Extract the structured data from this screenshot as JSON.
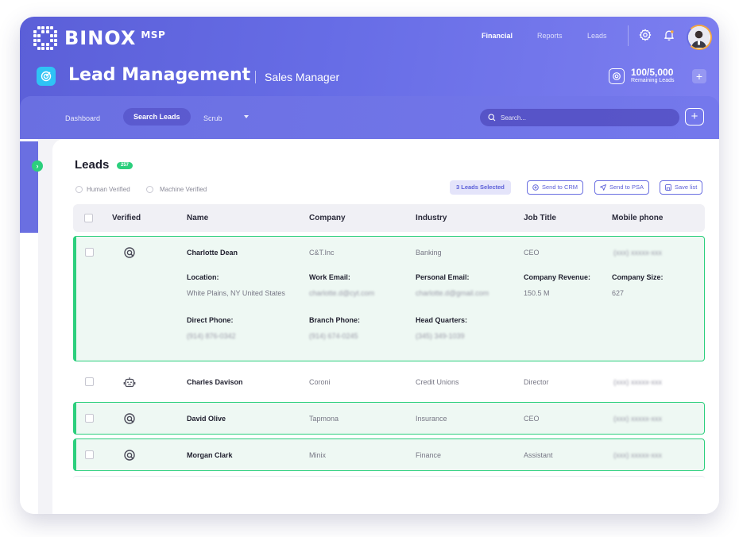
{
  "brand": {
    "name": "BINOX",
    "suffix": "MSP"
  },
  "topnav": {
    "items": [
      {
        "label": "Financial",
        "active": true
      },
      {
        "label": "Reports",
        "active": false
      },
      {
        "label": "Leads",
        "active": false
      }
    ]
  },
  "header": {
    "title": "Lead Management",
    "subtitle": "Sales Manager",
    "credits_value": "100/5,000",
    "credits_label": "Remaining Leads",
    "plus_label": "+"
  },
  "subnav": {
    "items": [
      {
        "label": "Dashboard",
        "active": false
      },
      {
        "label": "Search Leads",
        "active": true
      },
      {
        "label": "Scrub",
        "active": false
      }
    ],
    "search_placeholder": "Search...",
    "add_label": "+"
  },
  "rail": {
    "toggle_label": "›"
  },
  "leads": {
    "title": "Leads",
    "count": "257",
    "filters": [
      "Human Verified",
      "Machine Verified"
    ],
    "selected_label": "3 Leads Selected",
    "actions": [
      "Send to CRM",
      "Send to PSA",
      "Save list"
    ],
    "columns": [
      "Verified",
      "Name",
      "Company",
      "Industry",
      "Job Title",
      "Mobile phone"
    ],
    "rows": [
      {
        "name": "Charlotte Dean",
        "company": "C&T.Inc",
        "industry": "Banking",
        "job_title": "CEO",
        "mobile": "(xxx) xxxxx-xxx",
        "verified": "human",
        "selected": true,
        "expanded": true,
        "details": {
          "location_label": "Location:",
          "location": "White Plains, NY United States",
          "work_email_label": "Work Email:",
          "work_email": "charlotte.d@cyt.com",
          "personal_email_label": "Personal Email:",
          "personal_email": "charlotte.d@gmail.com",
          "revenue_label": "Company Revenue:",
          "revenue": "150.5 M",
          "size_label": "Company Size:",
          "size": "627",
          "direct_phone_label": "Direct Phone:",
          "direct_phone": "(914) 876-0342",
          "branch_phone_label": "Branch Phone:",
          "branch_phone": "(914) 674-0245",
          "hq_label": "Head Quarters:",
          "hq": "(345) 349-1039"
        }
      },
      {
        "name": "Charles Davison",
        "company": "Coroni",
        "industry": "Credit Unions",
        "job_title": "Director",
        "mobile": "(xxx) xxxxx-xxx",
        "verified": "machine",
        "selected": false
      },
      {
        "name": "David Olive",
        "company": "Tapmona",
        "industry": "Insurance",
        "job_title": "CEO",
        "mobile": "(xxx) xxxxx-xxx",
        "verified": "human",
        "selected": true
      },
      {
        "name": "Morgan Clark",
        "company": "Minix",
        "industry": "Finance",
        "job_title": "Assistant",
        "mobile": "(xxx) xxxxx-xxx",
        "verified": "human",
        "selected": true
      }
    ]
  },
  "colors": {
    "brand_gradient_start": "#5b5fd8",
    "brand_gradient_end": "#7d7ff0",
    "accent_green": "#2ccf7d",
    "selected_row_bg": "#eef8f3",
    "title_icon": "#2fc3f5",
    "avatar_ring": "#f5a740"
  },
  "icons": {
    "logo": "binox-dot-grid-logo",
    "settings": "gear-icon",
    "notifications": "bell-icon",
    "human_verified": "human-verified-icon",
    "machine_verified": "robot-icon",
    "search": "search-icon"
  }
}
